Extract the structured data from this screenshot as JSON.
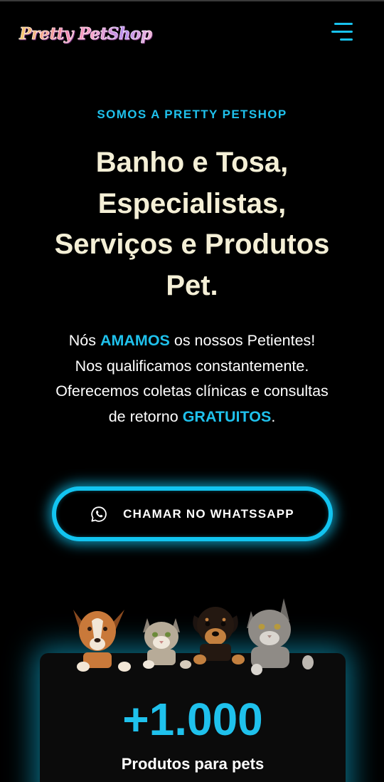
{
  "header": {
    "logo_text": "Pretty PetShop",
    "menu_icon": "hamburger-menu-icon"
  },
  "hero": {
    "eyebrow": "SOMOS A PRETTY PETSHOP",
    "title_lines": [
      "Banho e Tosa,",
      "Especialistas,",
      "Serviços e Produtos",
      "Pet."
    ],
    "text": {
      "p1_before": "Nós ",
      "p1_highlight": "AMAMOS",
      "p1_after": " os nossos Petientes!",
      "p2": "Nos qualificamos constantemente.",
      "p3": "Oferecemos coletas clínicas e consultas",
      "p4_before": "de retorno ",
      "p4_highlight": "GRATUITOS",
      "p4_after": "."
    }
  },
  "cta": {
    "label": "CHAMAR NO WHATSSAPP",
    "icon": "whatsapp-icon"
  },
  "stats": {
    "value": "+1.000",
    "label": "Produtos para pets",
    "image": "dogs-and-cats-peeking-illustration"
  },
  "colors": {
    "background": "#000000",
    "accent": "#1fc1ec",
    "title": "#f4efd6",
    "text": "#ffffff"
  }
}
